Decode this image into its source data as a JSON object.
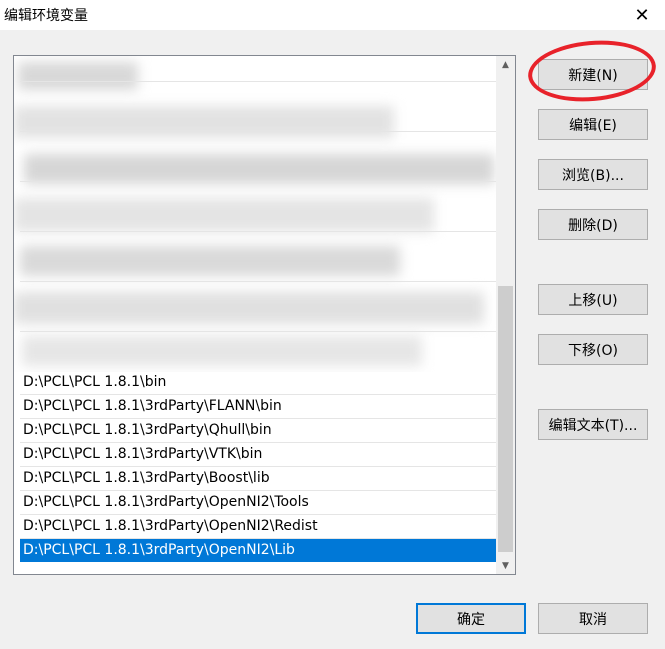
{
  "window": {
    "title": "编辑环境变量",
    "close_glyph": "✕"
  },
  "list": {
    "items": [
      "D:\\PCL\\PCL 1.8.1\\bin",
      "D:\\PCL\\PCL 1.8.1\\3rdParty\\FLANN\\bin",
      "D:\\PCL\\PCL 1.8.1\\3rdParty\\Qhull\\bin",
      "D:\\PCL\\PCL 1.8.1\\3rdParty\\VTK\\bin",
      "D:\\PCL\\PCL 1.8.1\\3rdParty\\Boost\\lib",
      "D:\\PCL\\PCL 1.8.1\\3rdParty\\OpenNI2\\Tools",
      "D:\\PCL\\PCL 1.8.1\\3rdParty\\OpenNI2\\Redist",
      "D:\\PCL\\PCL 1.8.1\\3rdParty\\OpenNI2\\Lib"
    ],
    "selected_index": 7
  },
  "buttons": {
    "new": "新建(N)",
    "edit": "编辑(E)",
    "browse": "浏览(B)...",
    "delete": "删除(D)",
    "move_up": "上移(U)",
    "move_down": "下移(O)",
    "edit_text": "编辑文本(T)...",
    "ok": "确定",
    "cancel": "取消"
  },
  "scrollbar": {
    "up_glyph": "▲",
    "down_glyph": "▼"
  },
  "colors": {
    "selection": "#0078d7",
    "annotation": "#e8222a"
  }
}
